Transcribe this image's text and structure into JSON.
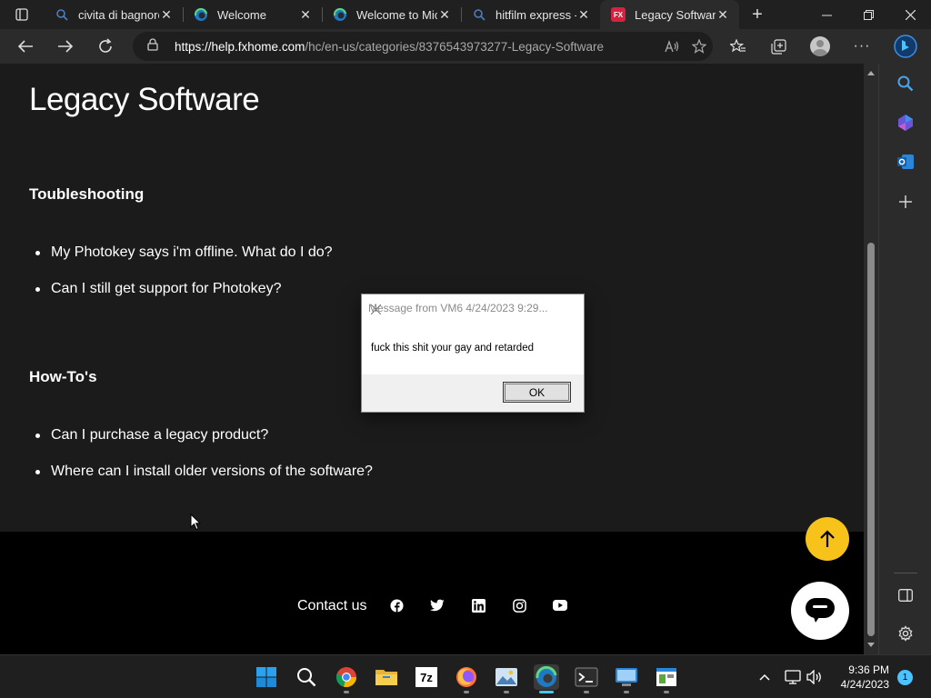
{
  "browser": {
    "tabs": [
      {
        "title": "civita di bagnore",
        "icon": "search-icon",
        "active": false
      },
      {
        "title": "Welcome",
        "icon": "edge-icon",
        "active": false
      },
      {
        "title": "Welcome to Micr",
        "icon": "edge-icon",
        "active": false
      },
      {
        "title": "hitfilm express - ",
        "icon": "search-icon",
        "active": false
      },
      {
        "title": "Legacy Software",
        "icon": "fxhome-icon",
        "active": true
      }
    ],
    "fx_favicon_text": "FX",
    "url_host": "https://help.fxhome.com",
    "url_path": "/hc/en-us/categories/8376543973277-Legacy-Software"
  },
  "page": {
    "title": "Legacy Software",
    "sections": [
      {
        "title": "Toubleshooting",
        "articles": [
          "My Photokey says i'm offline. What do I do?",
          "Can I still get support for Photokey?"
        ]
      },
      {
        "title": "How-To's",
        "articles": [
          "Can I purchase a legacy product?",
          "Where can I install older versions of the software?"
        ]
      }
    ],
    "footer": {
      "contact_label": "Contact us"
    },
    "accent_color": "#f7c21a"
  },
  "dialog": {
    "title": "Message from VM6  4/24/2023 9:29...",
    "message": "fuck this shit your gay and retarded",
    "ok_label": "OK"
  },
  "taskbar": {
    "time": "9:36 PM",
    "date": "4/24/2023",
    "notification_count": "1",
    "sevenzip_label": "7z"
  }
}
